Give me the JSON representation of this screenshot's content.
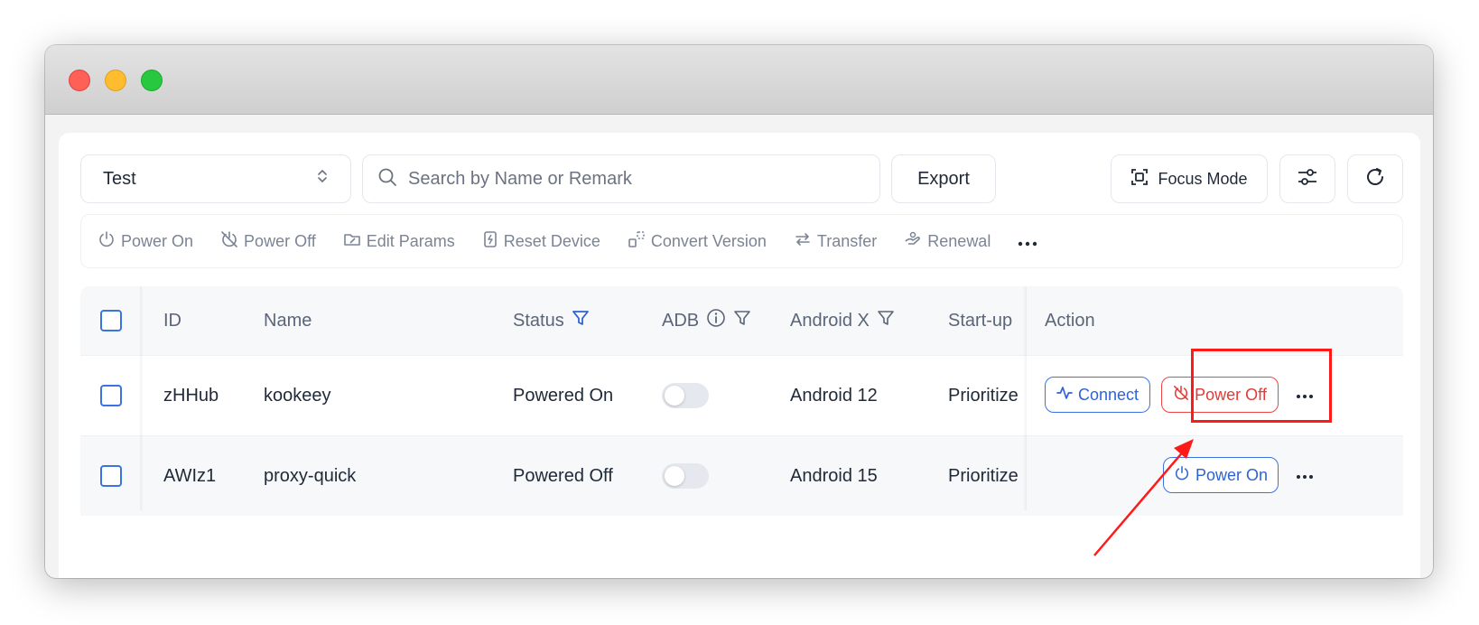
{
  "toolbar_top": {
    "group_select": "Test",
    "search_placeholder": "Search by Name or Remark",
    "export_label": "Export",
    "focus_mode_label": "Focus Mode"
  },
  "actions": {
    "power_on": "Power On",
    "power_off": "Power Off",
    "edit_params": "Edit Params",
    "reset_device": "Reset Device",
    "convert_version": "Convert Version",
    "transfer": "Transfer",
    "renewal": "Renewal"
  },
  "table": {
    "headers": {
      "id": "ID",
      "name": "Name",
      "status": "Status",
      "adb": "ADB",
      "android": "Android X",
      "startup": "Start-up",
      "action": "Action"
    },
    "rows": [
      {
        "id": "zHHub",
        "name": "kookeey",
        "status": "Powered On",
        "adb_enabled": false,
        "android": "Android 12",
        "startup": "Prioritize",
        "connect_label": "Connect",
        "power_label": "Power Off"
      },
      {
        "id": "AWIz1",
        "name": "proxy-quick",
        "status": "Powered Off",
        "adb_enabled": false,
        "android": "Android 15",
        "startup": "Prioritize",
        "power_label": "Power On"
      }
    ]
  },
  "colors": {
    "accent_blue": "#2f63d4",
    "danger_red": "#e53935",
    "annotation_red": "#ff1a1a"
  }
}
